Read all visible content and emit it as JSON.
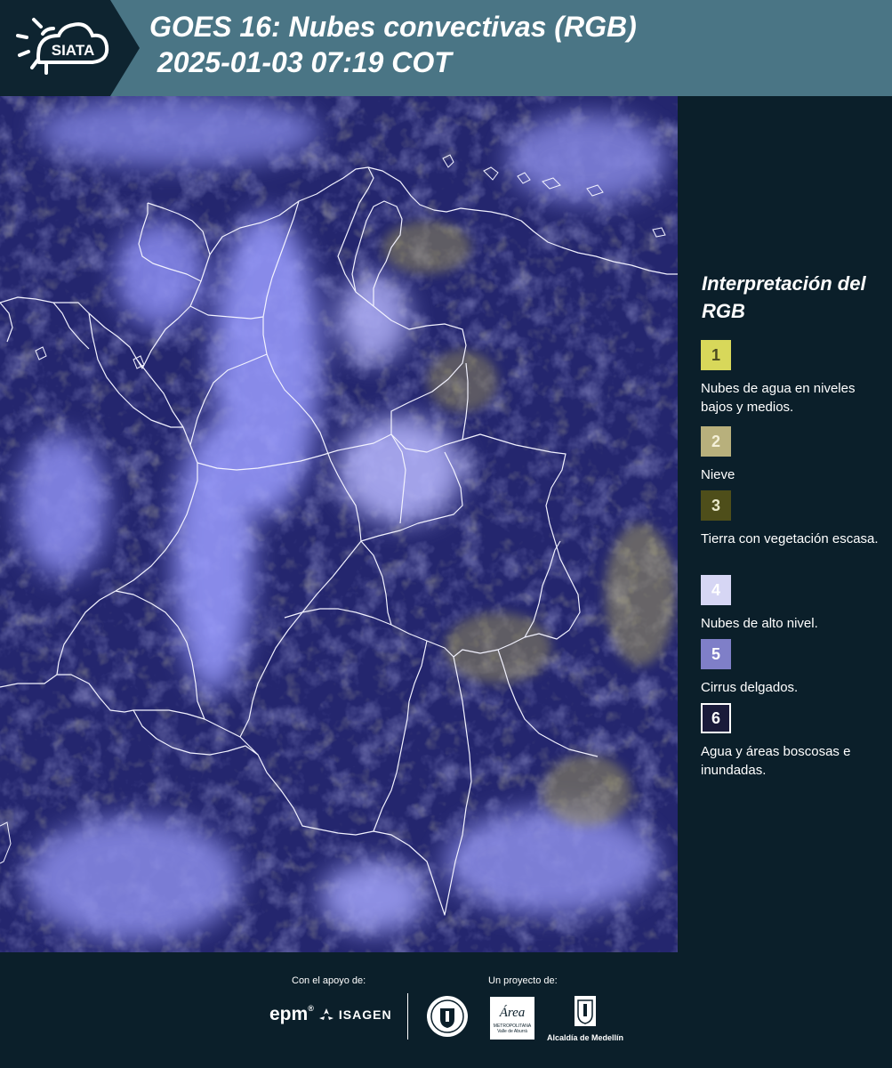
{
  "header": {
    "title_line1": "GOES 16: Nubes convectivas (RGB)",
    "title_line2": " 2025-01-03 07:19 COT",
    "logo_text": "SIATA",
    "logo_icon": "sun-cloud-icon"
  },
  "legend": {
    "title": "Interpretación del RGB",
    "items": [
      {
        "number": "1",
        "label": "Nubes de agua en niveles bajos y medios.",
        "color": "#d8d85a",
        "text_color": "#4a4a20"
      },
      {
        "number": "2",
        "label": "Nieve",
        "color": "#b8b07c",
        "text_color": "#f4f0d8"
      },
      {
        "number": "3",
        "label": "Tierra con vegetación escasa.",
        "color": "#4e4e1a",
        "text_color": "#e8e8c8"
      },
      {
        "number": "4",
        "label": "Nubes de alto nivel.",
        "color": "#d6d6f4",
        "text_color": "#ffffff"
      },
      {
        "number": "5",
        "label": "Cirrus delgados.",
        "color": "#7f7fc8",
        "text_color": "#ffffff"
      },
      {
        "number": "6",
        "label": "Agua y áreas boscosas e inundadas.",
        "color": "#1a1b3a",
        "text_color": "#ffffff"
      }
    ]
  },
  "footer": {
    "support_label": "Con el apoyo de:",
    "project_label": "Un proyecto de:",
    "sponsor_epm": "epm",
    "sponsor_isagen": "ISAGEN",
    "partner_area": "Área",
    "partner_area_sub": "METROPOLITANA",
    "partner_area_sub2": "Valle de Aburrá",
    "partner_alcaldia": "Alcaldía de Medellín"
  },
  "colors": {
    "header_bg": "#4a7585",
    "page_bg": "#0b1f2a",
    "cloud_high": "#d0d0ff",
    "cloud_low": "#c8c070",
    "background_dark": "#20226a"
  }
}
